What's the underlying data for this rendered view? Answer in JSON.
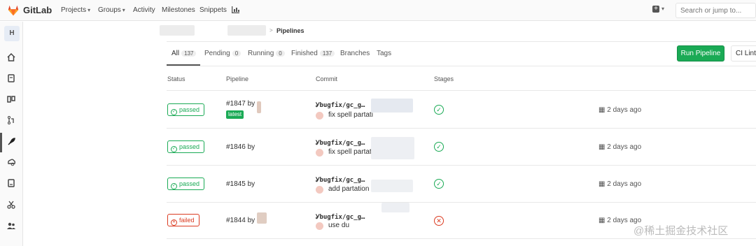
{
  "header": {
    "brand": "GitLab",
    "nav": [
      "Projects",
      "Groups",
      "Activity",
      "Milestones",
      "Snippets"
    ],
    "search_placeholder": "Search or jump to..."
  },
  "sidebar": {
    "avatar_letter": "H",
    "items": [
      "home-icon",
      "issues-icon",
      "board-icon",
      "merge-request-icon",
      "rocket-icon",
      "operations-icon",
      "wiki-icon",
      "snippets-icon",
      "members-icon"
    ]
  },
  "breadcrumb": {
    "current": "Pipelines"
  },
  "tabs": [
    {
      "label": "All",
      "count": "137"
    },
    {
      "label": "Pending",
      "count": "0"
    },
    {
      "label": "Running",
      "count": "0"
    },
    {
      "label": "Finished",
      "count": "137"
    },
    {
      "label": "Branches"
    },
    {
      "label": "Tags"
    }
  ],
  "buttons": {
    "run_pipeline": "Run Pipeline",
    "ci_lint": "CI Lint"
  },
  "columns": {
    "status": "Status",
    "pipeline": "Pipeline",
    "commit": "Commit",
    "stages": "Stages"
  },
  "pipelines": [
    {
      "status": "passed",
      "id": "#1847 by",
      "badge": "latest",
      "branch": "bugfix/gc_g…",
      "message": "fix spell partati",
      "time": "2 days ago"
    },
    {
      "status": "passed",
      "id": "#1846 by",
      "branch": "bugfix/gc_g…",
      "message": "fix spell partati",
      "time": "2 days ago"
    },
    {
      "status": "passed",
      "id": "#1845 by",
      "branch": "bugfix/gc_g…",
      "message": "add partation",
      "time": "2 days ago"
    },
    {
      "status": "failed",
      "id": "#1844 by",
      "branch": "bugfix/gc_g…",
      "message": "use du",
      "time": "2 days ago"
    }
  ],
  "watermark": "@稀土掘金技术社区",
  "colors": {
    "success": "#1aaa55",
    "danger": "#db3b21",
    "brand_orange": "#e24329"
  }
}
